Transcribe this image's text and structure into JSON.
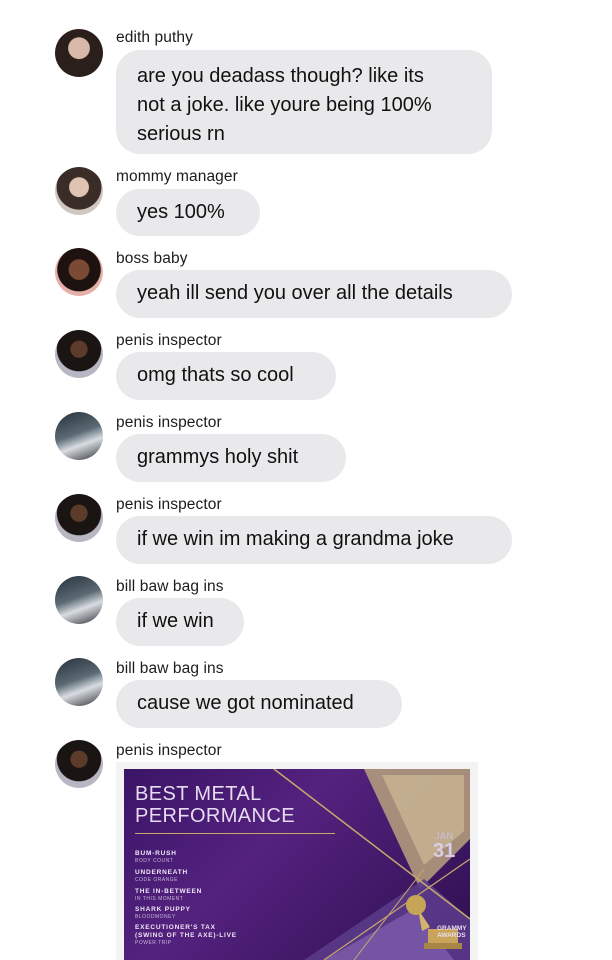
{
  "messages": [
    {
      "sender": "edith puthy",
      "lines": [
        "are you deadass though? like its",
        "not a joke. like youre being 100%",
        "serious rn"
      ]
    },
    {
      "sender": "mommy manager",
      "text": "yes 100%"
    },
    {
      "sender": "boss baby",
      "text": "yeah ill send you over all the details"
    },
    {
      "sender": "penis inspector",
      "text": "omg thats so cool"
    },
    {
      "sender": "penis inspector",
      "text": "grammys holy shit"
    },
    {
      "sender": "penis inspector",
      "text": "if we win im making a grandma joke"
    },
    {
      "sender": "bill baw bag ins",
      "text": "if we win"
    },
    {
      "sender": "bill baw bag ins",
      "text": "cause we got nominated"
    },
    {
      "sender": "penis inspector"
    }
  ],
  "award_image": {
    "title_line1": "BEST METAL",
    "title_line2": "PERFORMANCE",
    "date_month": "JAN",
    "date_day": "31",
    "brand": "GRAMMY\nAWARDS",
    "nominees": [
      {
        "name": "BUM-RUSH",
        "sub": "BODY COUNT"
      },
      {
        "name": "UNDERNEATH",
        "sub": "CODE ORANGE"
      },
      {
        "name": "THE IN-BETWEEN",
        "sub": "IN THIS MOMENT"
      },
      {
        "name": "SHARK PUPPY",
        "sub": "BLOODMONEY"
      },
      {
        "name": "EXECUTIONER'S TAX",
        "name2": "(SWING OF THE AXE)-LIVE",
        "sub": "POWER TRIP"
      }
    ],
    "colors": {
      "bg": "#3a1466",
      "gold": "#c9a96b"
    }
  }
}
